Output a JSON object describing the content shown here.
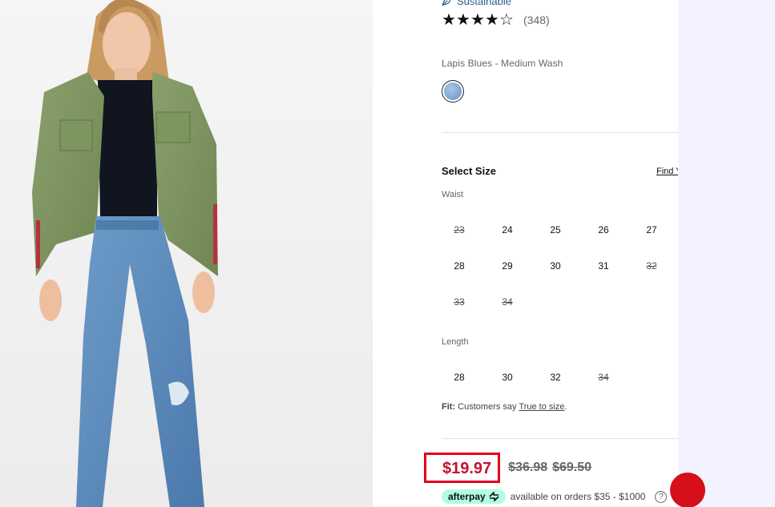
{
  "product": {
    "sustainable_label": "Sustainable",
    "rating": {
      "value": 4.5,
      "count_text": "(348)"
    },
    "color": {
      "name": "Lapis Blues - Medium Wash",
      "swatch_color": "#8fb2da"
    }
  },
  "size_selector": {
    "title": "Select Size",
    "find_link": "Find Y",
    "waist_label": "Waist",
    "waist_options": [
      {
        "label": "23",
        "available": false
      },
      {
        "label": "24",
        "available": true
      },
      {
        "label": "25",
        "available": true
      },
      {
        "label": "26",
        "available": true
      },
      {
        "label": "27",
        "available": true
      },
      {
        "label": "28",
        "available": true
      },
      {
        "label": "29",
        "available": true
      },
      {
        "label": "30",
        "available": true
      },
      {
        "label": "31",
        "available": true
      },
      {
        "label": "32",
        "available": false
      },
      {
        "label": "33",
        "available": false
      },
      {
        "label": "34",
        "available": false
      }
    ],
    "length_label": "Length",
    "length_options": [
      {
        "label": "28",
        "available": true
      },
      {
        "label": "30",
        "available": true
      },
      {
        "label": "32",
        "available": true
      },
      {
        "label": "34",
        "available": false
      }
    ]
  },
  "fit": {
    "label": "Fit:",
    "text": "Customers say",
    "link_text": "True to size",
    "suffix": "."
  },
  "pricing": {
    "sale_price": "$19.97",
    "prior_price": "$36.98",
    "original_price": "$69.50",
    "sale_color": "#c41230",
    "highlight_color": "#e3001b"
  },
  "afterpay": {
    "badge_text": "afterpay",
    "text": "available on orders $35 - $1000",
    "help_icon": "help-icon"
  },
  "colors": {
    "accent": "#d50f1b",
    "link_blue": "#2d5b8f"
  }
}
